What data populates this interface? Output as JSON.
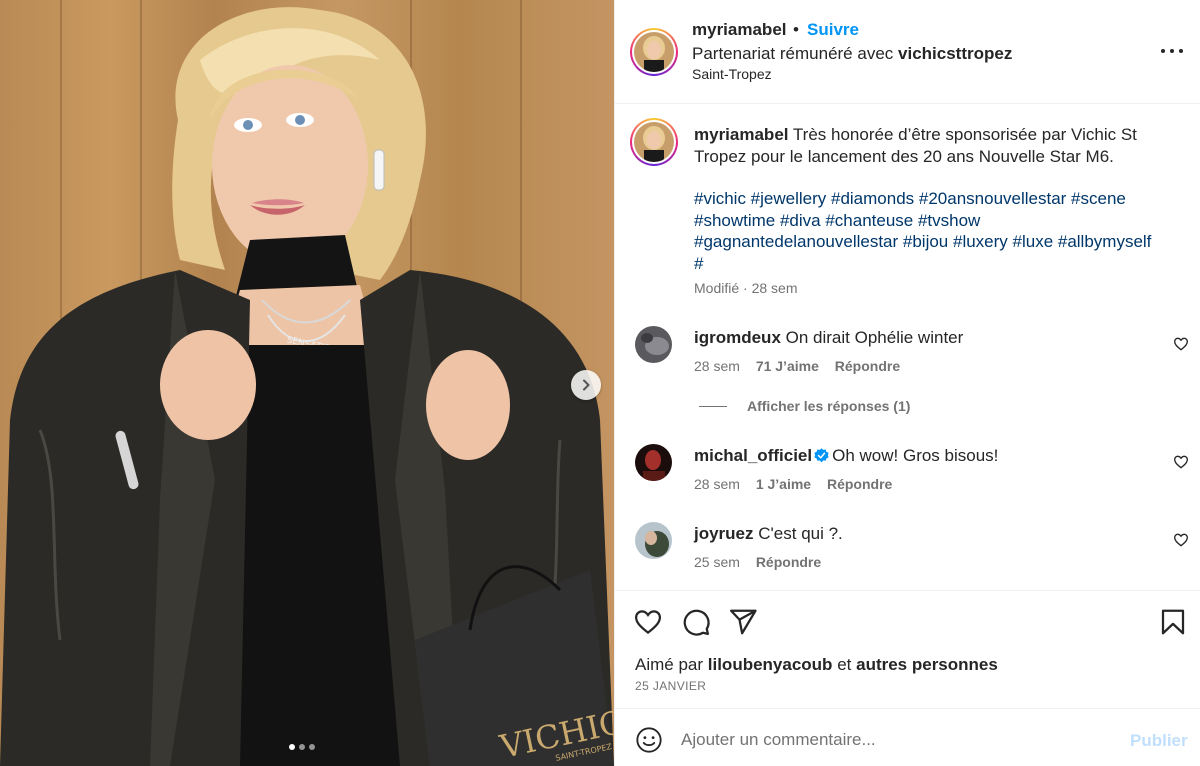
{
  "post": {
    "username": "myriamabel",
    "separator": "•",
    "follow_label": "Suivre",
    "partnership_prefix": "Partenariat rémunéré avec",
    "partner_name": "vichicsttropez",
    "location": "Saint-Tropez",
    "carousel": {
      "total_slides": 3,
      "active_slide": 1
    },
    "photo": {
      "bag_brand": "VICHIC",
      "bag_sub": "SAINT-TROPEZ",
      "necklace_text": "SENSATIONS"
    }
  },
  "caption": {
    "username": "myriamabel",
    "text": "Très honorée d’être sponsorisée par Vichic St Tropez pour le lancement des 20 ans Nouvelle Star M6.",
    "hashtags_line1": "#vichic #jewellery #diamonds #20ansnouvellestar #scene",
    "hashtags_line2": "#showtime #diva #chanteuse #tvshow",
    "hashtags_line3": "#gagnantedelanouvellestar #bijou #luxery #luxe #allbymyself",
    "hashtags_line4": "#",
    "edited_label": "Modifié",
    "dot": "·",
    "time": "28 sem"
  },
  "comments": [
    {
      "username": "igromdeux",
      "text": "On dirait Ophélie winter",
      "time": "28 sem",
      "likes": "71 J’aime",
      "reply_label": "Répondre",
      "verified": false
    },
    {
      "username": "michal_officiel",
      "text": "Oh wow! Gros bisous!",
      "time": "28 sem",
      "likes": "1 J’aime",
      "reply_label": "Répondre",
      "verified": true
    },
    {
      "username": "joyruez",
      "text": "C'est qui ?.",
      "time": "25 sem",
      "likes": "",
      "reply_label": "Répondre",
      "verified": false
    }
  ],
  "view_replies_label": "Afficher les réponses (1)",
  "actions": {
    "icons": [
      "heart-icon",
      "comment-icon",
      "share-icon",
      "bookmark-icon"
    ]
  },
  "likes_summary": {
    "prefix": "Aimé par",
    "user": "liloubenyacoub",
    "connector": "et",
    "others": "autres personnes"
  },
  "post_date": "25 JANVIER",
  "composer": {
    "placeholder": "Ajouter un commentaire...",
    "publish_label": "Publier"
  },
  "colors": {
    "accent": "#0095f6",
    "hashtag": "#00376b",
    "muted": "#737373",
    "publish_disabled": "#c0dffd",
    "verified": "#0095f6"
  }
}
